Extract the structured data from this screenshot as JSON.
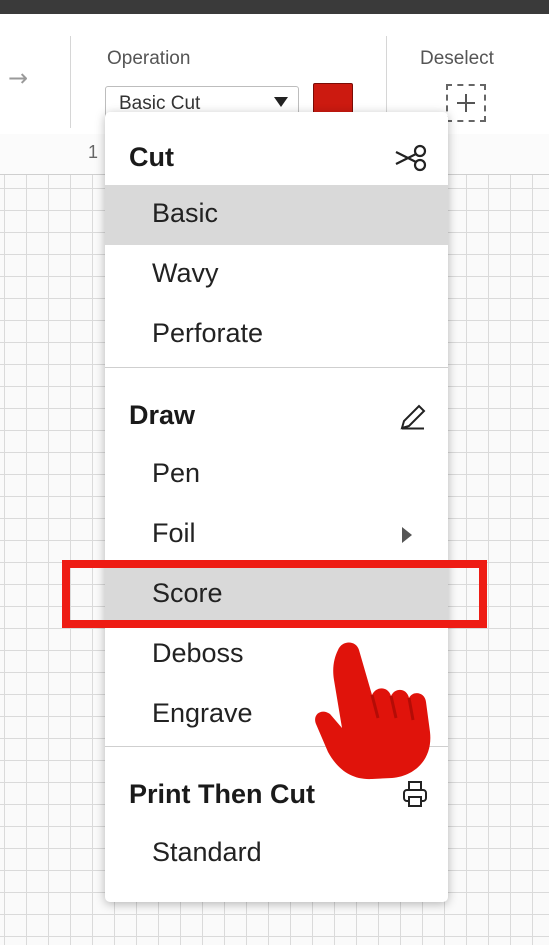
{
  "toolbar": {
    "operation_label": "Operation",
    "operation_value": "Basic Cut",
    "color_swatch": "#cc1a10",
    "deselect_label": "Deselect"
  },
  "ruler": {
    "first_mark": "1"
  },
  "menu": {
    "sections": [
      {
        "title": "Cut",
        "icon": "scissors-icon",
        "items": [
          {
            "label": "Basic",
            "selected": true
          },
          {
            "label": "Wavy"
          },
          {
            "label": "Perforate"
          }
        ]
      },
      {
        "title": "Draw",
        "icon": "pen-icon",
        "items": [
          {
            "label": "Pen"
          },
          {
            "label": "Foil",
            "has_submenu": true
          },
          {
            "label": "Score",
            "highlighted": true
          },
          {
            "label": "Deboss"
          },
          {
            "label": "Engrave"
          }
        ]
      },
      {
        "title": "Print Then Cut",
        "icon": "printer-icon",
        "items": [
          {
            "label": "Standard"
          }
        ]
      }
    ]
  },
  "annotations": {
    "highlight_color": "#ee1c14",
    "pointer": "hand-pointer-icon"
  }
}
